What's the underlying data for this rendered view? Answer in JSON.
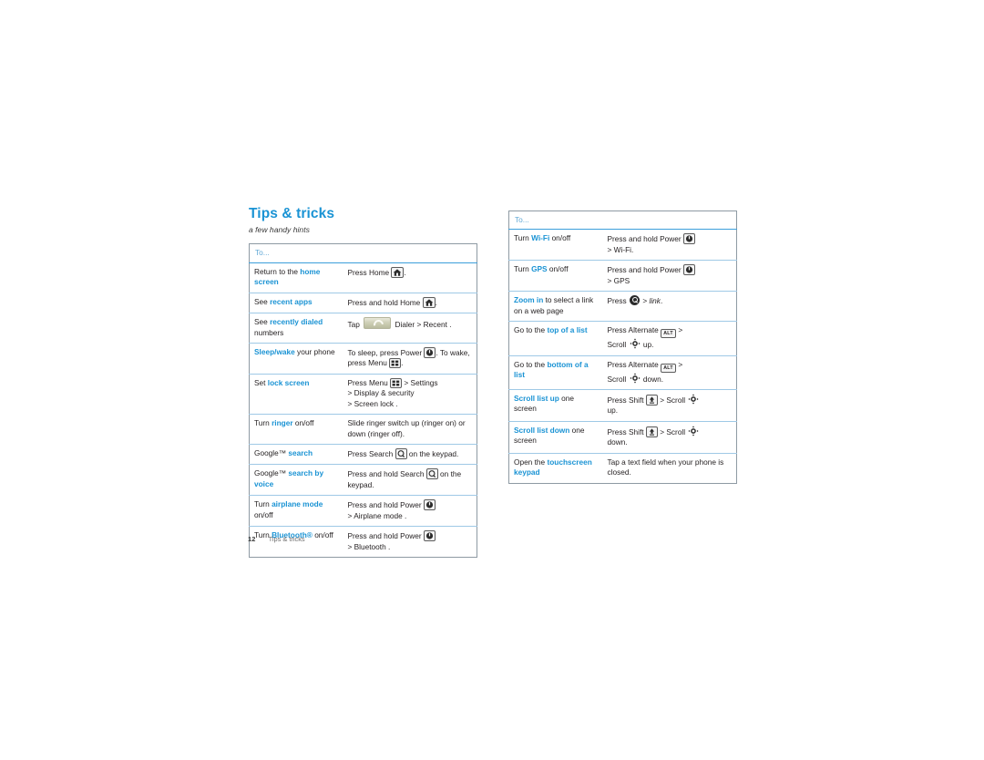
{
  "document": {
    "title": "Tips & tricks",
    "subtitle": "a few handy hints",
    "footer": {
      "page_number": "12",
      "section": "Tips & tricks"
    },
    "colors": {
      "accent_blue": "#1a93d4",
      "header_blue": "#62a9d6",
      "rule_blue": "#3c9fdb",
      "row_rule": "#9fc9e6",
      "table_border": "#8e9aa3",
      "text": "#231f20"
    }
  },
  "left_table": {
    "header": "To...",
    "rows": [
      {
        "action_pre": "Return to the ",
        "action_hl": "home screen",
        "action_post": "",
        "result_line1_pre": "Press Home ",
        "result_icon1": "home-key-icon",
        "result_line1_post": ".",
        "result_line2": ""
      },
      {
        "action_pre": "See ",
        "action_hl": "recent apps",
        "action_post": "",
        "result_line1_pre": "Press and hold Home ",
        "result_icon1": "home-key-icon",
        "result_line1_post": ".",
        "result_line2": ""
      },
      {
        "action_pre": "See ",
        "action_hl": "recently dialed",
        "action_post": " numbers",
        "result_line1_pre": "Tap ",
        "result_icon1": "dialer-icon",
        "result_line1_post": " Dialer  > Recent .",
        "result_line2": ""
      },
      {
        "action_pre": "",
        "action_hl": "Sleep/wake",
        "action_post": " your phone",
        "result_line1_pre": "To sleep, press Power ",
        "result_icon1": "power-key-icon",
        "result_line1_post": ". To",
        "result_line2_pre": "wake, press Menu ",
        "result_icon2": "menu-key-icon",
        "result_line2_post": "."
      },
      {
        "action_pre": "Set ",
        "action_hl": "lock screen",
        "action_post": "",
        "result_line1_pre": "Press Menu ",
        "result_icon1": "menu-key-icon",
        "result_line1_post": " > Settings",
        "result_line2": "> Display & security",
        "result_line3": "> Screen lock ."
      },
      {
        "action_pre": "Turn ",
        "action_hl": "ringer",
        "action_post": " on/off",
        "result_line1_plain": "Slide ringer switch up (ringer",
        "result_line2": "on) or down (ringer off)."
      },
      {
        "action_pre": "Google™ ",
        "action_hl": "search",
        "action_post": "",
        "result_line1_pre": "Press Search ",
        "result_icon1": "search-key-icon",
        "result_line1_post": " on the",
        "result_line2": "keypad."
      },
      {
        "action_pre": "Google™ ",
        "action_hl": "search by voice",
        "action_post": "",
        "result_line1_pre": "Press and hold Search ",
        "result_icon1": "search-key-icon",
        "result_line1_post": " on",
        "result_line2": "the keypad."
      },
      {
        "action_pre": "Turn ",
        "action_hl": "airplane mode",
        "action_post": " on/off",
        "result_line1_pre": "Press and hold Power ",
        "result_icon1": "power-key-icon",
        "result_line1_post": "",
        "result_line2": "> Airplane mode  ."
      },
      {
        "action_pre": "Turn ",
        "action_hl": "Bluetooth®",
        "action_post": " on/off",
        "result_line1_pre": "Press and hold Power ",
        "result_icon1": "power-key-icon",
        "result_line1_post": "",
        "result_line2": "> Bluetooth  ."
      }
    ]
  },
  "right_table": {
    "header": "To...",
    "rows": [
      {
        "action_pre": "Turn ",
        "action_hl": "Wi-Fi",
        "action_post": " on/off",
        "result_line1_pre": "Press and hold Power ",
        "result_icon1": "power-key-icon",
        "result_line1_post": "",
        "result_line2": "> Wi-Fi."
      },
      {
        "action_pre": "Turn ",
        "action_hl": "GPS",
        "action_post": " on/off",
        "result_line1_pre": "Press and hold Power ",
        "result_icon1": "power-key-icon",
        "result_line1_post": "",
        "result_line2": "> GPS"
      },
      {
        "action_pre": "",
        "action_hl": "Zoom in",
        "action_post": " to select a link on a web page",
        "result_line1_pre": "Press ",
        "result_icon1": "zoom-icon",
        "result_line1_post": " > ",
        "result_line1_italic": "link",
        "result_line1_tail": ".",
        "result_line2": ""
      },
      {
        "action_pre": "Go to the ",
        "action_hl": "top of a list",
        "action_post": "",
        "result_line1_pre": "Press Alternate ",
        "result_icon1": "alt-key-icon",
        "result_line1_post": " >",
        "result_line2_pre": "Scroll ",
        "result_icon2": "scroll-icon",
        "result_line2_post": " up."
      },
      {
        "action_pre": "Go to the ",
        "action_hl": "bottom of a list",
        "action_post": "",
        "result_line1_pre": "Press Alternate ",
        "result_icon1": "alt-key-icon",
        "result_line1_post": " >",
        "result_line2_pre": "Scroll ",
        "result_icon2": "scroll-icon",
        "result_line2_post": " down."
      },
      {
        "action_pre": "",
        "action_hl": "Scroll list up",
        "action_post": " one screen",
        "result_line1_pre": "Press Shift ",
        "result_icon1": "shift-key-icon",
        "result_line1_mid": " > Scroll ",
        "result_icon2": "scroll-icon",
        "result_line2": "up."
      },
      {
        "action_pre": "",
        "action_hl": "Scroll list down",
        "action_post": " one screen",
        "result_line1_pre": "Press Shift ",
        "result_icon1": "shift-key-icon",
        "result_line1_mid": " > Scroll ",
        "result_icon2": "scroll-icon",
        "result_line2": "down."
      },
      {
        "action_pre": "Open the ",
        "action_hl": "touchscreen keypad",
        "action_post": "",
        "result_line1_plain": "Tap a text field when your",
        "result_line2": "phone is closed."
      }
    ]
  },
  "icons": {
    "home_key": "home-key-icon",
    "power_key": "power-key-icon",
    "menu_key": "menu-key-icon",
    "search_key": "search-key-icon",
    "alt_key_label": "ALT",
    "shift_key": "shift-key-icon",
    "dialer": "dialer-icon",
    "zoom": "zoom-icon",
    "scroll": "scroll-icon"
  }
}
